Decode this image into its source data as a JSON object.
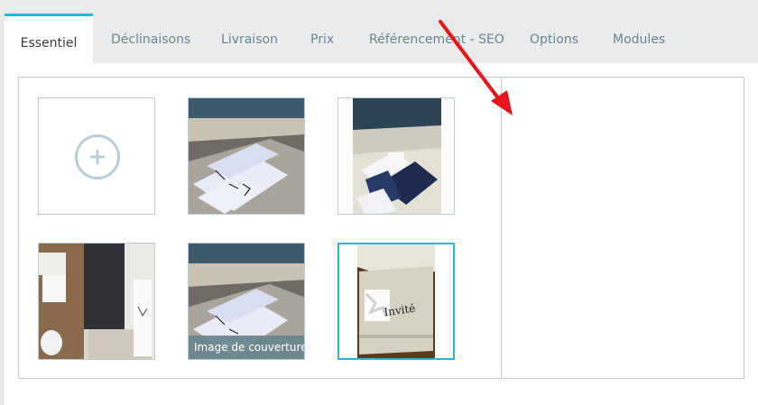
{
  "tabs": [
    {
      "label": "Essentiel",
      "active": true
    },
    {
      "label": "Déclinaisons"
    },
    {
      "label": "Livraison"
    },
    {
      "label": "Prix"
    },
    {
      "label": "Référencement - SEO"
    },
    {
      "label": "Options"
    },
    {
      "label": "Modules"
    }
  ],
  "images": {
    "cover_caption": "Image de couverture",
    "invite_text": "Invité"
  },
  "colors": {
    "accent": "#25b9d7",
    "annotation_arrow": "#e8141a",
    "border": "#bbcdd2"
  }
}
